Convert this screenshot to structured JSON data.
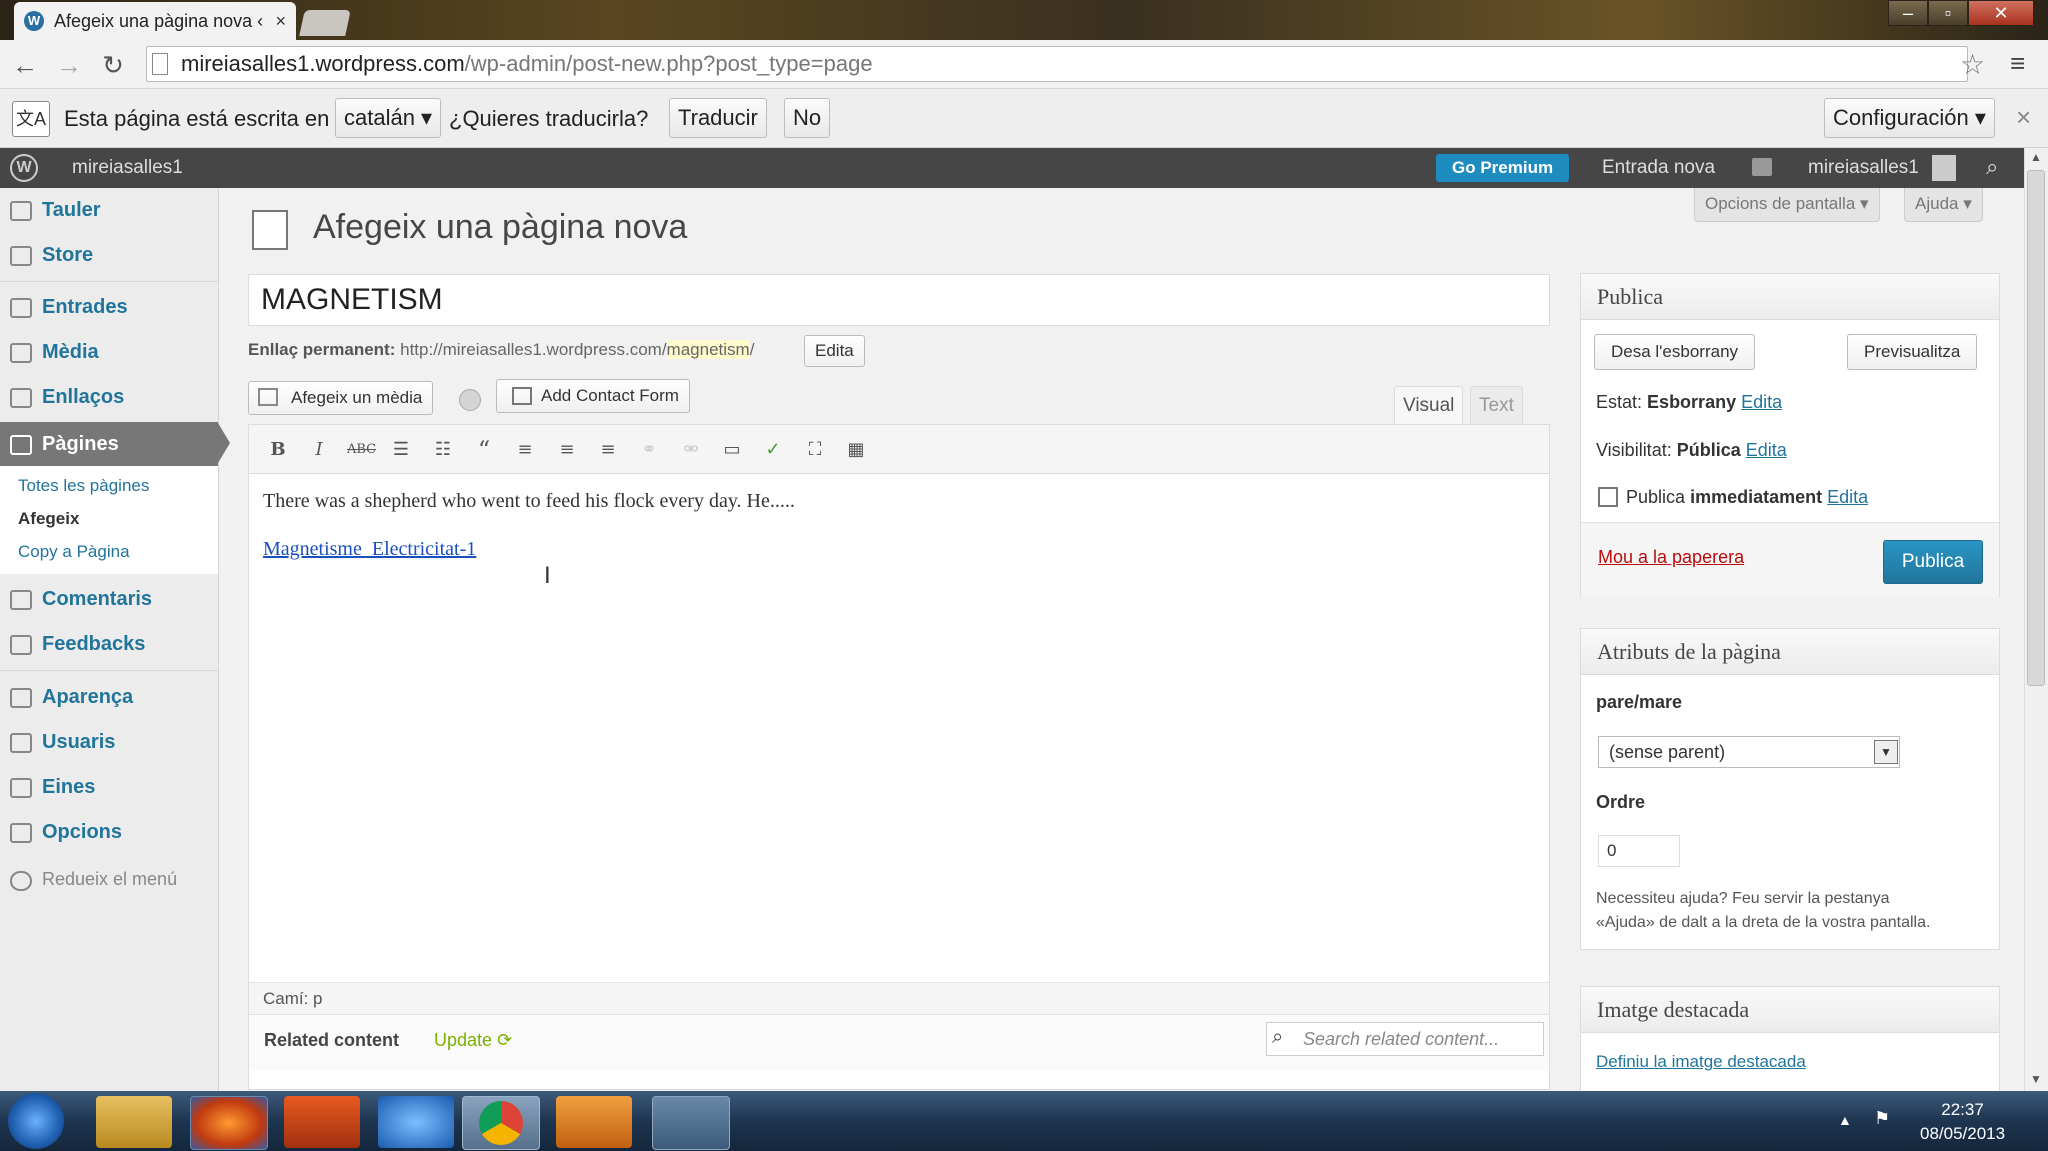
{
  "browser": {
    "tab_title": "Afegeix una pàgina nova ‹",
    "tab_close": "×",
    "url_host": "mireiasalles1.wordpress.com",
    "url_path": "/wp-admin/post-new.php?post_type=page"
  },
  "translate_bar": {
    "prompt": "Esta página está escrita en",
    "language": "catalán ▾",
    "question": "¿Quieres traducirla?",
    "translate_button": "Traducir",
    "no_button": "No",
    "settings_button": "Configuración ▾",
    "close": "×"
  },
  "admin_bar": {
    "site_name": "mireiasalles1",
    "go_premium": "Go Premium",
    "new_post": "Entrada nova",
    "user": "mireiasalles1"
  },
  "sidebar": {
    "items": [
      {
        "label": "Tauler"
      },
      {
        "label": "Store"
      },
      {
        "label": "Entrades"
      },
      {
        "label": "Mèdia"
      },
      {
        "label": "Enllaços"
      },
      {
        "label": "Pàgines"
      },
      {
        "label": "Comentaris"
      },
      {
        "label": "Feedbacks"
      },
      {
        "label": "Aparença"
      },
      {
        "label": "Usuaris"
      },
      {
        "label": "Eines"
      },
      {
        "label": "Opcions"
      },
      {
        "label": "Redueix el menú"
      }
    ],
    "submenu": [
      "Totes les pàgines",
      "Afegeix",
      "Copy a Pàgina"
    ]
  },
  "main": {
    "page_title": "Afegeix una pàgina nova",
    "screen_options": "Opcions de pantalla ▾",
    "help": "Ajuda ▾",
    "post_title": "MAGNETISM",
    "permalink_label": "Enllaç permanent:",
    "permalink_base": "http://mireiasalles1.wordpress.com/",
    "permalink_slug": "magnetism",
    "permalink_trail": "/",
    "permalink_edit": "Edita",
    "add_media": "Afegeix un mèdia",
    "add_contact_form": "Add Contact Form",
    "tab_visual": "Visual",
    "tab_text": "Text",
    "content_paragraph": "There was a shepherd who went to feed his flock every day. He.....",
    "content_link": "Magnetisme_Electricitat-1",
    "path": "Camí: p",
    "related_label": "Related content",
    "related_update": "Update",
    "related_search_placeholder": "Search related content..."
  },
  "publish_box": {
    "title": "Publica",
    "save_draft": "Desa l'esborrany",
    "preview": "Previsualitza",
    "status_label": "Estat:",
    "status_value": "Esborrany",
    "visibility_label": "Visibilitat:",
    "visibility_value": "Pública",
    "publish_label": "Publica",
    "publish_value": "immediatament",
    "edit": "Edita",
    "trash": "Mou a la paperera",
    "publish_button": "Publica"
  },
  "attributes_box": {
    "title": "Atributs de la pàgina",
    "parent_label": "pare/mare",
    "parent_value": "(sense parent)",
    "order_label": "Ordre",
    "order_value": "0",
    "help_text_1": "Necessiteu ajuda? Feu servir la pestanya",
    "help_text_2": "«Ajuda» de dalt a la dreta de la vostra pantalla."
  },
  "featured_box": {
    "title": "Imatge destacada",
    "link": "Definiu la imatge destacada"
  },
  "taskbar": {
    "time": "22:37",
    "date": "08/05/2013"
  },
  "colors": {
    "wp_link": "#21759b",
    "publish_button": "#21759b",
    "admin_bar": "#464646",
    "go_premium": "#1e8cbe"
  }
}
